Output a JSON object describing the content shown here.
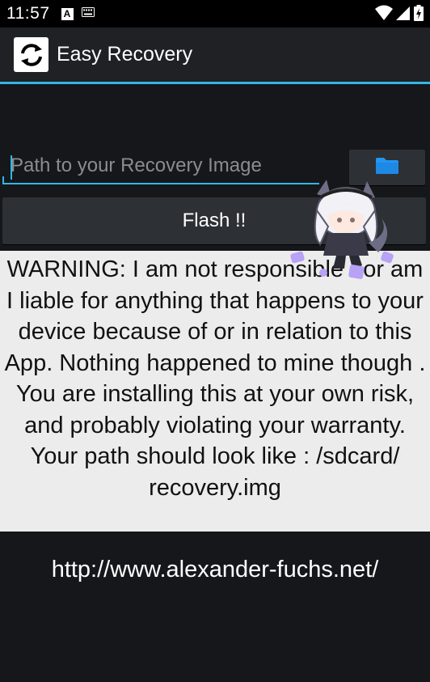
{
  "status_bar": {
    "time": "11:57",
    "a_icon": "A"
  },
  "app": {
    "title": "Easy Recovery"
  },
  "path_input": {
    "placeholder": "Path to your Recovery Image",
    "value": ""
  },
  "flash_button": {
    "label": "Flash !!"
  },
  "warning": {
    "text": "WARNING: I am not responsible nor am I liable for anything that happens to your device because of or in relation to this App. Nothing happened to mine though . You are installing this at your own risk, and probably violating your warranty. Your path should look like : /sdcard/ recovery.img"
  },
  "website": {
    "url": "http://www.alexander-fuchs.net/"
  },
  "colors": {
    "accent": "#33b5e5",
    "background": "#15171a",
    "panel": "#ececec",
    "button": "#2d3034",
    "folder_icon": "#2196f3"
  },
  "icons": {
    "app": "refresh-sync-icon",
    "browse": "folder-icon",
    "status": [
      "keyboard-icon",
      "wifi-icon",
      "signal-icon",
      "battery-icon"
    ]
  }
}
